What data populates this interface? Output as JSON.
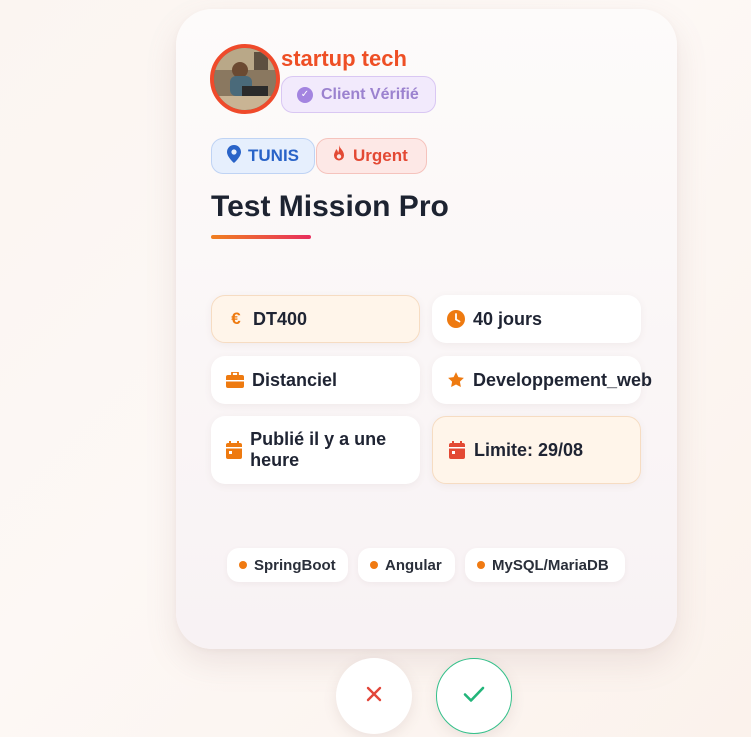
{
  "client": {
    "company_name": "startup tech",
    "verified_label": "Client Vérifié"
  },
  "tags": {
    "location": "TUNIS",
    "urgency": "Urgent"
  },
  "mission": {
    "title": "Test Mission Pro"
  },
  "details": {
    "budget": "DT400",
    "duration": "40 jours",
    "work_mode": "Distanciel",
    "category": "Developpement_web",
    "published": "Publié il y a une heure",
    "deadline": "Limite: 29/08"
  },
  "skills": [
    "SpringBoot",
    "Angular",
    "MySQL/MariaDB"
  ],
  "icons": {
    "location": "map-pin-icon",
    "urgency": "flame-icon",
    "budget": "euro-icon",
    "duration": "clock-icon",
    "work_mode": "briefcase-icon",
    "category": "star-icon",
    "published": "calendar-icon",
    "deadline": "calendar-icon",
    "reject": "close-icon",
    "accept": "check-icon"
  },
  "colors": {
    "accent": "#ee4f25",
    "icon_orange": "#ee7a10",
    "verified": "#9b82cf",
    "location": "#2963c8",
    "urgent": "#e34934",
    "reject": "#e2463a",
    "accept": "#22b57a"
  }
}
